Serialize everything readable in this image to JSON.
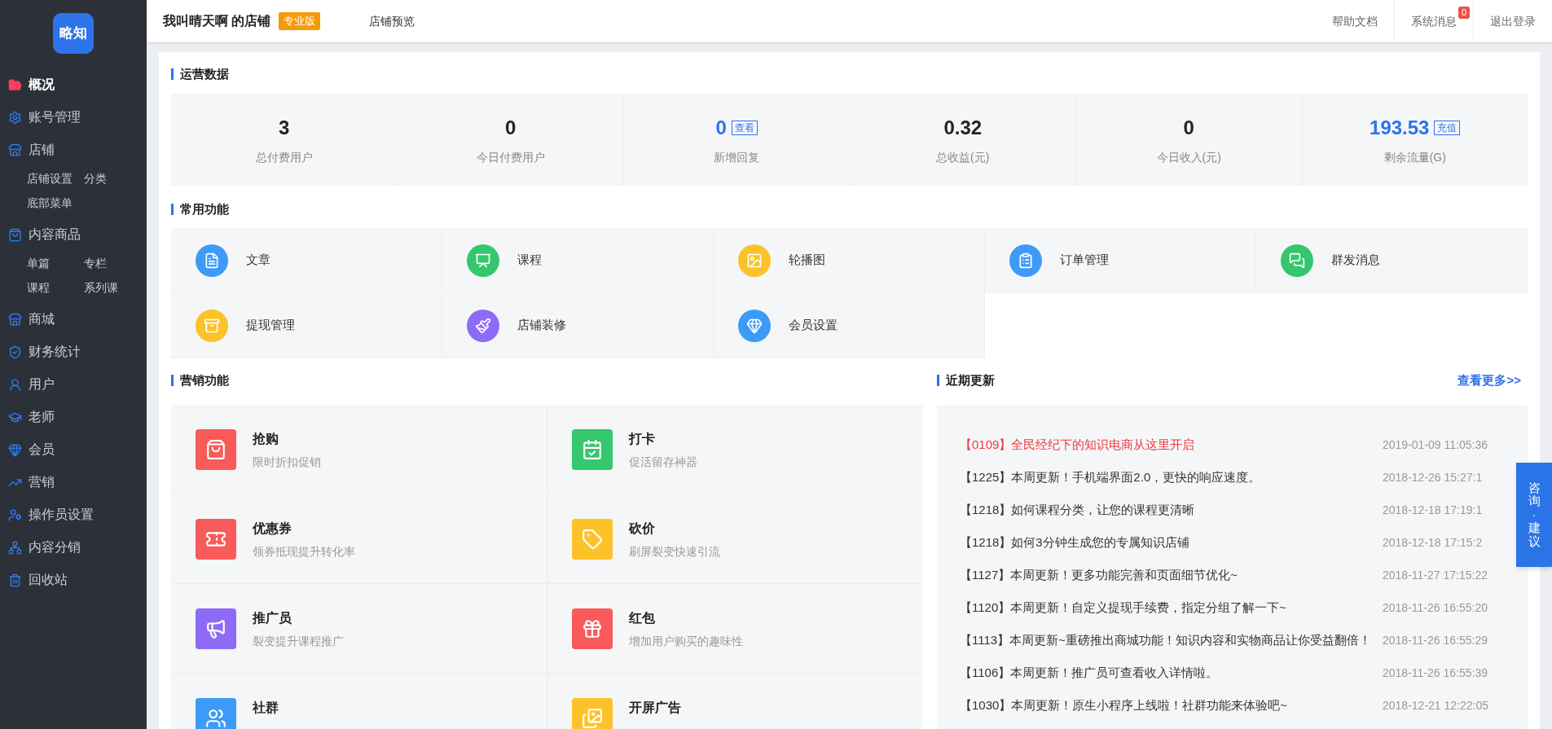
{
  "sidebar": {
    "logo": "略知",
    "items": [
      {
        "label": "概况",
        "selected": true
      },
      {
        "label": "账号管理",
        "selected": false
      },
      {
        "label": "店铺",
        "selected": false,
        "children": [
          {
            "label": "店铺设置"
          },
          {
            "label": "分类"
          },
          {
            "label": "底部菜单"
          }
        ]
      },
      {
        "label": "内容商品",
        "selected": false,
        "children": [
          {
            "label": "单篇"
          },
          {
            "label": "专栏"
          },
          {
            "label": "课程"
          },
          {
            "label": "系列课"
          }
        ]
      },
      {
        "label": "商城",
        "selected": false
      },
      {
        "label": "财务统计",
        "selected": false
      },
      {
        "label": "用户",
        "selected": false
      },
      {
        "label": "老师",
        "selected": false
      },
      {
        "label": "会员",
        "selected": false
      },
      {
        "label": "营销",
        "selected": false
      },
      {
        "label": "操作员设置",
        "selected": false
      },
      {
        "label": "内容分销",
        "selected": false
      },
      {
        "label": "回收站",
        "selected": false
      }
    ]
  },
  "topbar": {
    "store_name": "我叫晴天啊 的店铺",
    "edition_badge": "专业版",
    "preview_link": "店铺预览",
    "links": [
      {
        "label": "帮助文档"
      },
      {
        "label": "系统消息",
        "badge": "0"
      },
      {
        "label": "退出登录"
      }
    ]
  },
  "operations": {
    "title": "运营数据",
    "stats": [
      {
        "value": "3",
        "label": "总付费用户"
      },
      {
        "value": "0",
        "label": "今日付费用户"
      },
      {
        "value": "0",
        "label": "新增回复",
        "action": "查看"
      },
      {
        "value": "0.32",
        "label": "总收益(元)"
      },
      {
        "value": "0",
        "label": "今日收入(元)"
      },
      {
        "value": "193.53",
        "label": "剩余流量(G)",
        "action": "充值"
      }
    ]
  },
  "common_functions": {
    "title": "常用功能",
    "items": [
      {
        "label": "文章",
        "color": "#3d9bf7"
      },
      {
        "label": "课程",
        "color": "#34c76e"
      },
      {
        "label": "轮播图",
        "color": "#fcc22a"
      },
      {
        "label": "订单管理",
        "color": "#3d9bf7"
      },
      {
        "label": "群发消息",
        "color": "#34c76e"
      },
      {
        "label": "提现管理",
        "color": "#fcc22a"
      },
      {
        "label": "店铺装修",
        "color": "#8d6bf6"
      },
      {
        "label": "会员设置",
        "color": "#3d9bf7"
      }
    ]
  },
  "marketing": {
    "title": "营销功能",
    "items": [
      {
        "title": "抢购",
        "description": "限时折扣促销",
        "color": "#f95a5a"
      },
      {
        "title": "打卡",
        "description": "促活留存神器",
        "color": "#34c76e"
      },
      {
        "title": "优惠券",
        "description": "领券抵现提升转化率",
        "color": "#f95a5a"
      },
      {
        "title": "砍价",
        "description": "刷屏裂变快速引流",
        "color": "#fcc22a"
      },
      {
        "title": "推广员",
        "description": "裂变提升课程推广",
        "color": "#8d6bf6"
      },
      {
        "title": "红包",
        "description": "增加用户购买的趣味性",
        "color": "#f95a5a"
      },
      {
        "title": "社群",
        "color": "#3d9bf7"
      },
      {
        "title": "开屏广告",
        "color": "#fcc22a"
      }
    ]
  },
  "recent_updates": {
    "title": "近期更新",
    "more_link": "查看更多>>",
    "items": [
      {
        "text": "【0109】全民经纪下的知识电商从这里开启",
        "date": "2019-01-09 11:05:36",
        "highlighted": true
      },
      {
        "text": "【1225】本周更新！手机端界面2.0，更快的响应速度。",
        "date": "2018-12-26 15:27:1",
        "highlighted": false
      },
      {
        "text": "【1218】如何课程分类，让您的课程更清晰",
        "date": "2018-12-18 17:19:1",
        "highlighted": false
      },
      {
        "text": "【1218】如何3分钟生成您的专属知识店铺",
        "date": "2018-12-18 17:15:2",
        "highlighted": false
      },
      {
        "text": "【1127】本周更新！更多功能完善和页面细节优化~",
        "date": "2018-11-27 17:15:22",
        "highlighted": false
      },
      {
        "text": "【1120】本周更新！自定义提现手续费，指定分组了解一下~",
        "date": "2018-11-26 16:55:20",
        "highlighted": false
      },
      {
        "text": "【1113】本周更新~重磅推出商城功能！知识内容和实物商品让你受益翻倍！",
        "date": "2018-11-26 16:55:29",
        "highlighted": false
      },
      {
        "text": "【1106】本周更新！推广员可查看收入详情啦。",
        "date": "2018-11-26 16:55:39",
        "highlighted": false
      },
      {
        "text": "【1030】本周更新！原生小程序上线啦！社群功能来体验吧~",
        "date": "2018-12-21 12:22:05",
        "highlighted": false
      }
    ]
  },
  "consult_button": "咨询·建议"
}
